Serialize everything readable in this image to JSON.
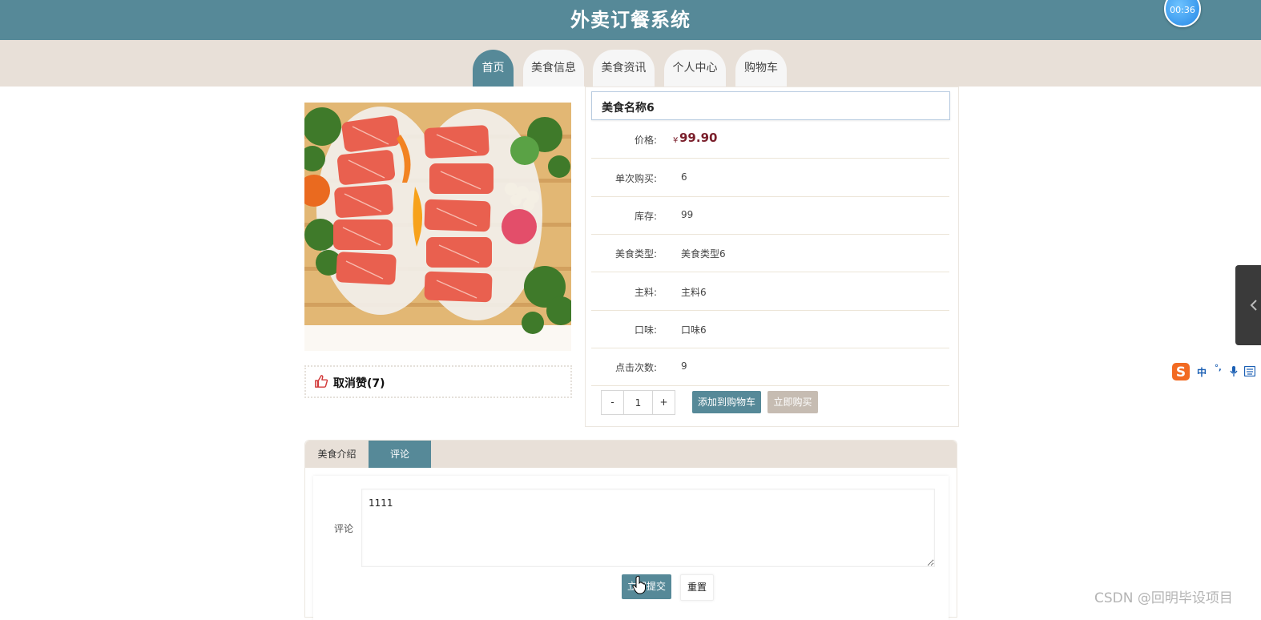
{
  "app": {
    "title": "外卖订餐系统",
    "timer": "00:36"
  },
  "nav": {
    "items": [
      {
        "label": "首页",
        "active": true
      },
      {
        "label": "美食信息",
        "active": false
      },
      {
        "label": "美食资讯",
        "active": false
      },
      {
        "label": "个人中心",
        "active": false
      },
      {
        "label": "购物车",
        "active": false
      }
    ]
  },
  "product": {
    "image_icon": "salmon-sashimi-photo",
    "name": "美食名称6",
    "like_icon": "thumbs-up-icon",
    "like_label": "取消赞(7)",
    "price_label": "价格:",
    "price_symbol": "¥",
    "price_value": "99.90",
    "rows": [
      {
        "label": "单次购买:",
        "value": "6"
      },
      {
        "label": "库存:",
        "value": "99"
      },
      {
        "label": "美食类型:",
        "value": "美食类型6"
      },
      {
        "label": "主料:",
        "value": "主料6"
      },
      {
        "label": "口味:",
        "value": "口味6"
      },
      {
        "label": "点击次数:",
        "value": "9"
      }
    ],
    "quantity": {
      "minus": "-",
      "value": "1",
      "plus": "+"
    },
    "add_to_cart_label": "添加到购物车",
    "buy_now_label": "立即购买"
  },
  "detail_tabs": {
    "items": [
      {
        "label": "美食介绍",
        "active": false
      },
      {
        "label": "评论",
        "active": true
      }
    ]
  },
  "comment": {
    "label": "评论",
    "value": "1111",
    "submit_label": "立即提交",
    "reset_label": "重置"
  },
  "ime": {
    "logo": "sogou-s-icon",
    "lang": "中",
    "punct": "°,",
    "mic_icon": "microphone-icon",
    "keyboard_icon": "keyboard-icon"
  },
  "watermark": "CSDN @回明毕设项目",
  "colors": {
    "primary": "#568998",
    "nav_bg": "#e8e0d8",
    "price": "#7a1f2b",
    "buy_button": "#c6bcb2",
    "like_icon": "#d23a3a"
  }
}
